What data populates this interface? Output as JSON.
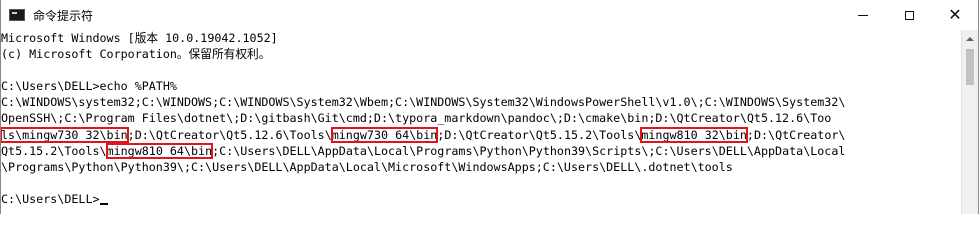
{
  "window": {
    "title": "命令提示符",
    "controls": {
      "minimize_icon": "minimize-icon",
      "maximize_icon": "maximize-icon",
      "close_glyph": "✕"
    }
  },
  "console": {
    "lines": [
      {
        "segments": [
          {
            "text": "Microsoft Windows [版本 10.0.19042.1052]"
          }
        ]
      },
      {
        "segments": [
          {
            "text": "(c) Microsoft Corporation。保留所有权利。"
          }
        ]
      },
      {
        "segments": [
          {
            "text": ""
          }
        ]
      },
      {
        "segments": [
          {
            "text": "C:\\Users\\DELL>echo %PATH%"
          }
        ]
      },
      {
        "segments": [
          {
            "text": "C:\\WINDOWS\\system32;C:\\WINDOWS;C:\\WINDOWS\\System32\\Wbem;C:\\WINDOWS\\System32\\WindowsPowerShell\\v1.0\\;C:\\WINDOWS\\System32\\"
          }
        ]
      },
      {
        "segments": [
          {
            "text": "OpenSSH\\;C:\\Program Files\\dotnet\\;D:\\gitbash\\Git\\cmd;D:\\typora_markdown\\pandoc\\;D:\\cmake\\bin;D:\\QtCreator\\Qt5.12.6\\Too"
          }
        ]
      },
      {
        "segments": [
          {
            "text": "ls\\mingw730_32\\bin",
            "hl": true
          },
          {
            "text": ";D:\\QtCreator\\Qt5.12.6\\Tools\\"
          },
          {
            "text": "mingw730_64\\bin",
            "hl": true
          },
          {
            "text": ";D:\\QtCreator\\Qt5.15.2\\Tools\\"
          },
          {
            "text": "mingw810_32\\bin",
            "hl": true
          },
          {
            "text": ";D:\\QtCreator\\"
          }
        ]
      },
      {
        "segments": [
          {
            "text": "Qt5.15.2\\Tools\\"
          },
          {
            "text": "mingw810_64\\bin",
            "hl": true
          },
          {
            "text": ";C:\\Users\\DELL\\AppData\\Local\\Programs\\Python\\Python39\\Scripts\\;C:\\Users\\DELL\\AppData\\Local"
          }
        ]
      },
      {
        "segments": [
          {
            "text": "\\Programs\\Python\\Python39\\;C:\\Users\\DELL\\AppData\\Local\\Microsoft\\WindowsApps;C:\\Users\\DELL\\.dotnet\\tools"
          }
        ]
      },
      {
        "segments": [
          {
            "text": ""
          }
        ]
      },
      {
        "segments": [
          {
            "text": "C:\\Users\\DELL>"
          }
        ],
        "cursor": true
      }
    ]
  },
  "colors": {
    "highlight_box": "#e0141a",
    "console_bg": "#ffffff",
    "console_text": "#000000"
  }
}
